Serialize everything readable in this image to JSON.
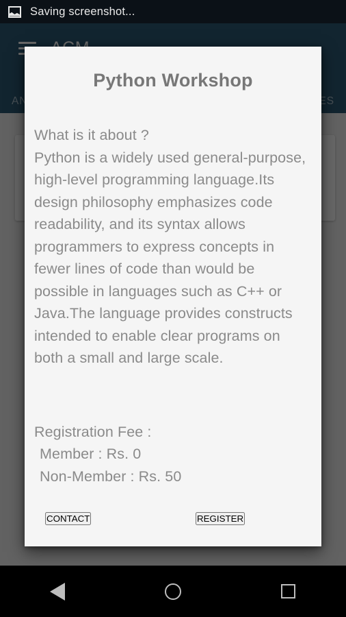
{
  "statusbar": {
    "icon": "image-screenshot-icon",
    "text": "Saving screenshot..."
  },
  "app": {
    "appbar": {
      "menu_icon": "hamburger-menu-icon",
      "title": "ACM",
      "background_color": "#0d4160"
    },
    "tabs": [
      {
        "label": "AN"
      },
      {
        "label": "AGES"
      }
    ]
  },
  "dialog": {
    "title": "Python Workshop",
    "about_heading": "What is it about ?",
    "about_text": "Python is a widely used general-purpose, high-level programming language.Its design philosophy emphasizes code readability, and its syntax allows programmers to express concepts in fewer lines of code than would be possible in languages such as C++ or Java.The language provides constructs intended to enable clear programs on both a small and large scale.",
    "fee_heading": "Registration Fee :",
    "fee_member": "Member : Rs.  0",
    "fee_non_member": "Non-Member : Rs.  50",
    "actions": {
      "contact": "CONTACT",
      "register": "REGISTER"
    },
    "background_color": "#f5f5f5",
    "title_color": "#777777",
    "body_color": "#8a8a8a"
  },
  "navbar": {
    "back": "back-icon",
    "home": "home-icon",
    "recents": "recents-icon"
  }
}
